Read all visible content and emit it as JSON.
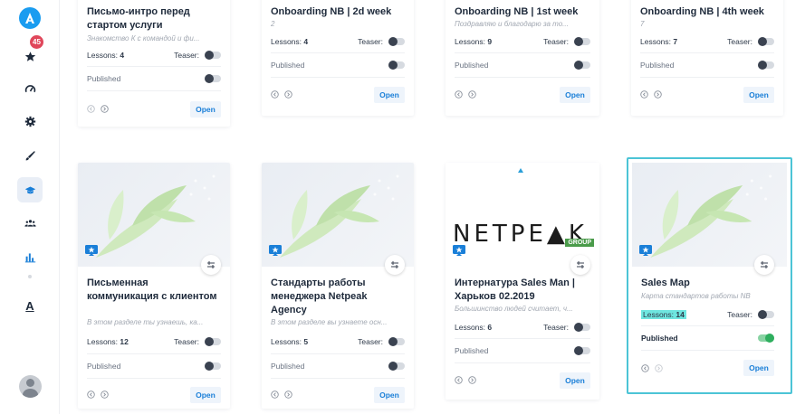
{
  "sidebar": {
    "badge_count": "45",
    "nav_letter": "A",
    "items": [
      {
        "icon": "star-icon"
      },
      {
        "icon": "gauge-icon"
      },
      {
        "icon": "gear-icon"
      },
      {
        "icon": "brush-icon"
      },
      {
        "icon": "graduation-cap-icon"
      },
      {
        "icon": "users-icon"
      },
      {
        "icon": "bar-chart-icon"
      }
    ]
  },
  "colors": {
    "accent": "#1a7fd8",
    "selected_border": "#4cc4d6",
    "toggle_on": "#2eae5e",
    "badge": "#e0475b"
  },
  "labels": {
    "lessons": "Lessons:",
    "teaser": "Teaser:",
    "published": "Published",
    "open": "Open"
  },
  "netpeak": {
    "logo": "NETPE▲K",
    "group": "GROUP"
  },
  "cards": [
    {
      "title": "Письмо-интро перед стартом услуги",
      "subtitle": "Знакомство К с командой и фи...",
      "lessons": "4"
    },
    {
      "title": "Onboarding NB | 2d week",
      "subtitle": "2",
      "lessons": "4"
    },
    {
      "title": "Onboarding NB | 1st week",
      "subtitle": "Поздравляю и благодарю за то...",
      "lessons": "9"
    },
    {
      "title": "Onboarding NB | 4th week",
      "subtitle": "7",
      "lessons": "7"
    },
    {
      "title": "Письменная коммуникация с клиентом",
      "subtitle": "В этом разделе ты узнаешь, ка...",
      "lessons": "12"
    },
    {
      "title": "Стандарты работы менеджера Netpeak Agency",
      "subtitle": "В этом разделе вы узнаете осн...",
      "lessons": "5"
    },
    {
      "title": "Интернатура Sales Man | Харьков 02.2019",
      "subtitle": "Большинство людей считает, ч...",
      "lessons": "6"
    },
    {
      "title": "Sales Map",
      "subtitle": "Карта стандартов работы NB",
      "lessons": "14"
    }
  ]
}
